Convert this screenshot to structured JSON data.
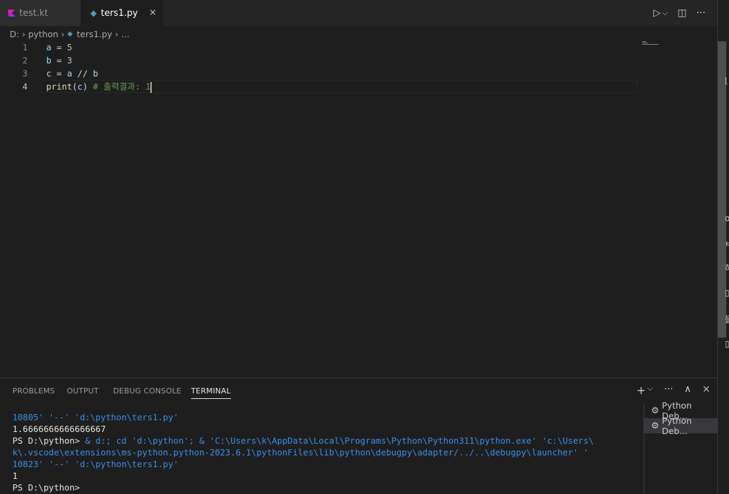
{
  "tabs": [
    {
      "label": "test.kt",
      "icon": "kotlin-icon"
    },
    {
      "label": "ters1.py",
      "icon": "python-icon",
      "close": "×"
    }
  ],
  "actions": {
    "run": "▷",
    "run_menu": "⌵",
    "split": "◫",
    "more": "···"
  },
  "breadcrumb": {
    "drive": "D:",
    "sep": "›",
    "folder": "python",
    "file": "ters1.py",
    "more": "..."
  },
  "editor": {
    "lines": [
      {
        "num": "1",
        "parts": [
          {
            "t": "a",
            "c": "var"
          },
          {
            "t": " = ",
            "c": "op"
          },
          {
            "t": "5",
            "c": "num"
          }
        ]
      },
      {
        "num": "2",
        "parts": [
          {
            "t": "b",
            "c": "var"
          },
          {
            "t": " = ",
            "c": "op"
          },
          {
            "t": "3",
            "c": "num"
          }
        ]
      },
      {
        "num": "3",
        "parts": [
          {
            "t": "c",
            "c": "var"
          },
          {
            "t": " = ",
            "c": "op"
          },
          {
            "t": "a",
            "c": "var"
          },
          {
            "t": " // ",
            "c": "op"
          },
          {
            "t": "b",
            "c": "var"
          }
        ]
      },
      {
        "num": "4",
        "parts": [
          {
            "t": "print",
            "c": "fn"
          },
          {
            "t": "(",
            "c": "op"
          },
          {
            "t": "c",
            "c": "var"
          },
          {
            "t": ") ",
            "c": "op"
          },
          {
            "t": "# 출력결과: 1",
            "c": "cmt"
          }
        ]
      }
    ]
  },
  "panel": {
    "tabs": [
      "PROBLEMS",
      "OUTPUT",
      "DEBUG CONSOLE",
      "TERMINAL"
    ],
    "active_tab": "TERMINAL",
    "actions": {
      "add": "+",
      "add_menu": "⌵",
      "more": "···",
      "maximize": "∧",
      "close": "×"
    }
  },
  "terminal": {
    "line1": "10805' '--' 'd:\\python\\ters1.py'",
    "line2": "1.6666666666666667",
    "line3_prompt": "PS D:\\python> ",
    "line3_cmd": "& d:; cd 'd:\\python'; & 'C:\\Users\\k\\AppData\\Local\\Programs\\Python\\Python311\\python.exe' 'c:\\Users\\",
    "line4": "k\\.vscode\\extensions\\ms-python.python-2023.6.1\\pythonFiles\\lib\\python\\debugpy\\adapter/../..\\debugpy\\launcher' '",
    "line5": "10823' '--' 'd:\\python\\ters1.py'",
    "line6": "1",
    "line7": "PS D:\\python> "
  },
  "terminal_list": [
    "Python Deb...",
    "Python Deb..."
  ],
  "right_glyphs": [
    "⌊",
    "ɑ",
    "ㅂ",
    "하",
    "▯",
    "들",
    "▯"
  ]
}
